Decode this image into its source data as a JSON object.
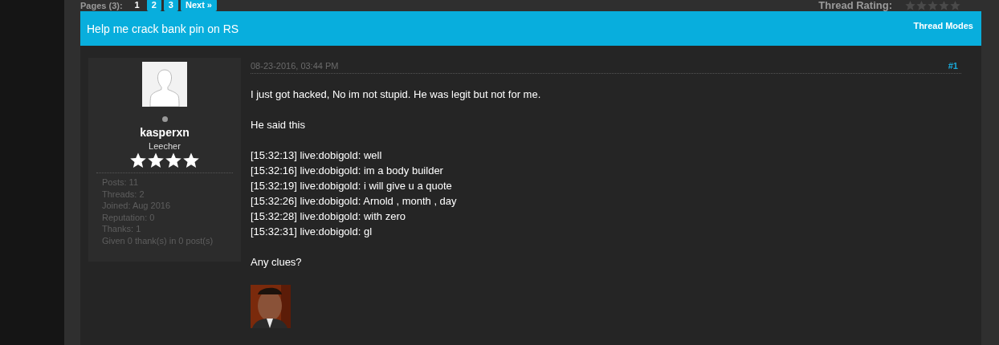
{
  "pagination": {
    "label": "Pages (3):",
    "pages": [
      {
        "label": "1",
        "selected": true
      },
      {
        "label": "2",
        "selected": false
      },
      {
        "label": "3",
        "selected": false
      }
    ],
    "next": "Next »"
  },
  "thread_rating": {
    "label": "Thread Rating:",
    "stars": 0
  },
  "thread": {
    "title": "Help me crack bank pin on RS",
    "modes": "Thread Modes"
  },
  "post": {
    "author": {
      "username": "kasperxn",
      "online": false,
      "rank": "Leecher",
      "stars": 4,
      "stats": [
        "Posts: 11",
        "Threads: 2",
        "Joined: Aug 2016",
        "Reputation: 0",
        "Thanks: 1",
        "Given 0 thank(s) in 0 post(s)"
      ]
    },
    "date": "08-23-2016, 03:44 PM",
    "number": "#1",
    "paragraphs": [
      [
        "I just got hacked, No im not stupid. He was legit but not for me."
      ],
      [
        "He said this"
      ],
      [
        "[15:32:13] live:dobigold: well",
        "[15:32:16] live:dobigold: im a body builder",
        "[15:32:19] live:dobigold: i will give u a quote",
        "[15:32:26] live:dobigold: Arnold , month , day",
        "[15:32:28] live:dobigold: with zero",
        "[15:32:31] live:dobigold: gl"
      ],
      [
        "Any clues?"
      ]
    ]
  }
}
